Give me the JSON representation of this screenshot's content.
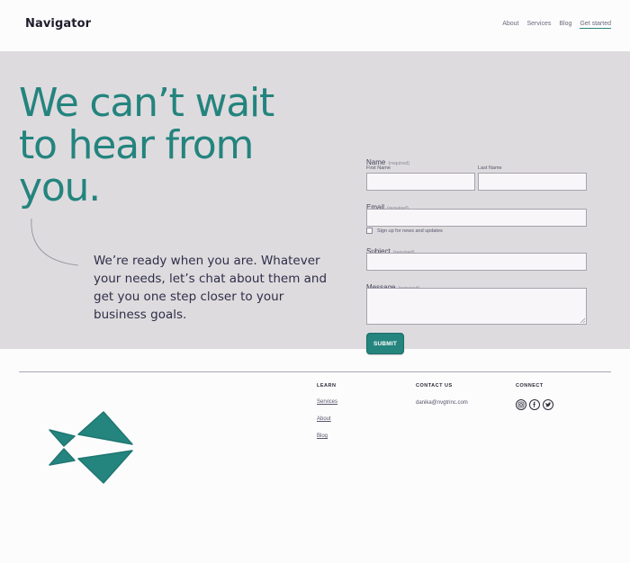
{
  "header": {
    "logo": "Navigator",
    "nav": [
      {
        "label": "About"
      },
      {
        "label": "Services"
      },
      {
        "label": "Blog"
      },
      {
        "label": "Get started"
      }
    ]
  },
  "hero": {
    "title": "We can’t wait to hear from you.",
    "copy": "We’re ready when you are. Whatever your needs, let’s chat about them and get you one step closer to your business goals."
  },
  "form": {
    "name_label": "Name",
    "required_text": "(required)",
    "first_name_label": "First Name",
    "last_name_label": "Last Name",
    "email_label": "Email",
    "newsletter_label": "Sign up for news and updates",
    "subject_label": "Subject",
    "message_label": "Message",
    "submit_label": "SUBMIT"
  },
  "footer": {
    "learn_heading": "LEARN",
    "learn_links": [
      "Services",
      "About",
      "Blog"
    ],
    "contact_heading": "CONTACT US",
    "contact_email": "danika@nvgtrinc.com",
    "connect_heading": "CONNECT",
    "social_icons": [
      "instagram-icon",
      "facebook-icon",
      "twitter-icon"
    ]
  },
  "colors": {
    "accent": "#24847e",
    "hero_bg": "#dedbde",
    "page_bg": "#fdfcfd"
  }
}
